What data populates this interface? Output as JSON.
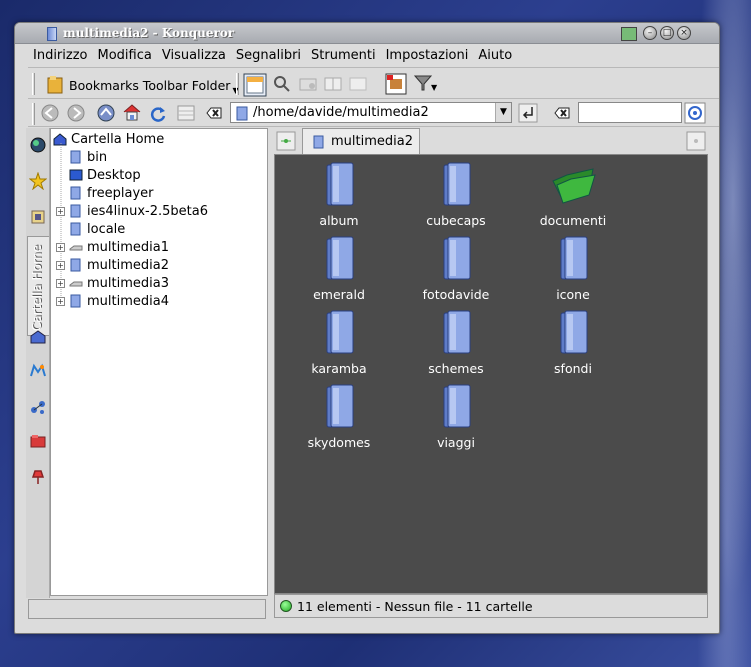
{
  "window": {
    "title": "multimedia2 - Konqueror"
  },
  "menu": [
    "Indirizzo",
    "Modifica",
    "Visualizza",
    "Segnalibri",
    "Strumenti",
    "Impostazioni",
    "Aiuto"
  ],
  "toolbar": {
    "bookmarks_folder": "Bookmarks Toolbar Folder"
  },
  "location": {
    "path": "/home/davide/multimedia2"
  },
  "sidebar": {
    "active_tab": "Cartella Home"
  },
  "tree": {
    "root": "Cartella Home",
    "items": [
      {
        "label": "bin",
        "expandable": false
      },
      {
        "label": "Desktop",
        "expandable": false
      },
      {
        "label": "freeplayer",
        "expandable": false
      },
      {
        "label": "ies4linux-2.5beta6",
        "expandable": true
      },
      {
        "label": "locale",
        "expandable": false
      },
      {
        "label": "multimedia1",
        "expandable": true
      },
      {
        "label": "multimedia2",
        "expandable": true
      },
      {
        "label": "multimedia3",
        "expandable": true
      },
      {
        "label": "multimedia4",
        "expandable": true
      }
    ]
  },
  "view": {
    "tab_label": "multimedia2",
    "items": [
      "album",
      "cubecaps",
      "documenti",
      "emerald",
      "fotodavide",
      "icone",
      "karamba",
      "schemes",
      "sfondi",
      "skydomes",
      "viaggi"
    ]
  },
  "status": {
    "text": "11 elementi - Nessun file - 11 cartelle"
  },
  "colors": {
    "view_bg": "#4b4b4b",
    "folder_blue": "#8fa8e6",
    "folder_green": "#3fb83f"
  }
}
